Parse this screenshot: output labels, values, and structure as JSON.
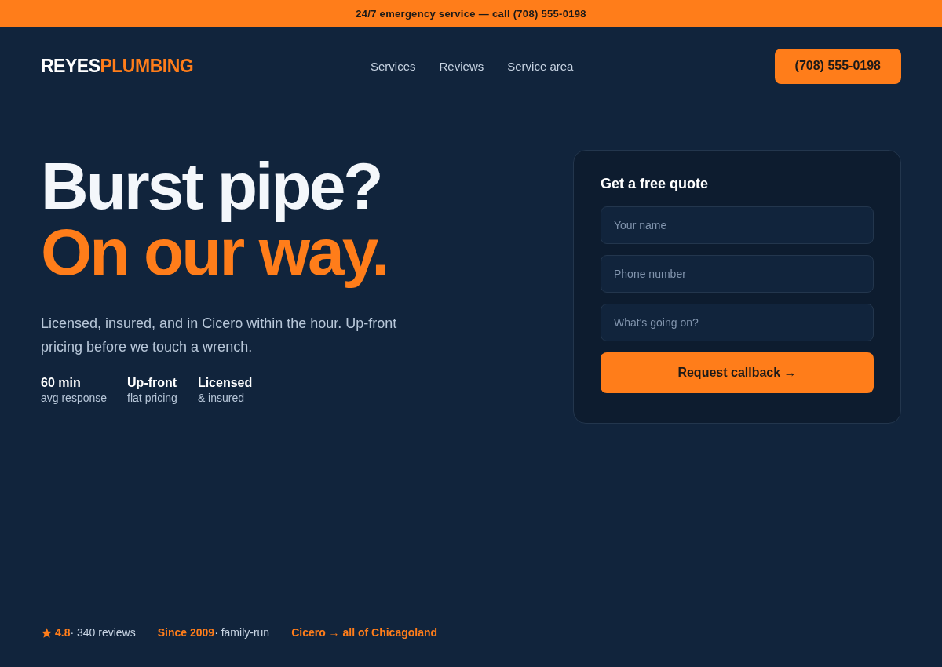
{
  "announcement": "24/7 emergency service — call (708) 555-0198",
  "logo": {
    "first": "REYES",
    "second": "PLUMBING"
  },
  "nav": [
    "Services",
    "Reviews",
    "Service area"
  ],
  "phone_button": "(708) 555-0198",
  "headline": [
    {
      "text": "Burst pipe?",
      "accent": false
    },
    {
      "text": "On our way.",
      "accent": true
    }
  ],
  "intro": "Licensed, insured, and in Cicero within the hour. Up-front pricing before we touch a wrench.",
  "stats": [
    {
      "value": "60 min",
      "label": "avg response"
    },
    {
      "value": "Up-front",
      "label": "flat pricing"
    },
    {
      "value": "Licensed",
      "label": "& insured"
    }
  ],
  "quote_form": {
    "title": "Get a free quote",
    "fields": [
      {
        "placeholder": "Your name"
      },
      {
        "placeholder": "Phone number"
      },
      {
        "placeholder": "What's going on?"
      }
    ],
    "submit": "Request callback →"
  },
  "proof": [
    {
      "kind": "rating",
      "highlight": "4.8",
      "text": "· 340 reviews"
    },
    {
      "kind": "plain",
      "highlight": "Since 2009",
      "text": "· family-run"
    },
    {
      "kind": "plain",
      "highlight": "Cicero → all of Chicagoland"
    }
  ]
}
